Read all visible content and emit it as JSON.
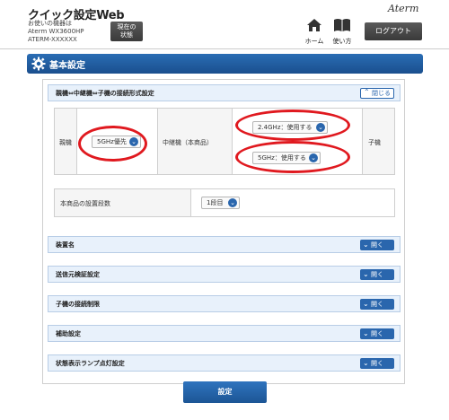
{
  "header": {
    "app_title": "クイック設定Web",
    "device_lines": [
      "お使いの機器は",
      "Aterm WX3600HP",
      "ATERM-XXXXXX"
    ],
    "status_button": [
      "現在の",
      "状態"
    ],
    "brand": "Aterm",
    "home_label": "ホーム",
    "help_label": "使い方",
    "logout_label": "ログアウト"
  },
  "page": {
    "title": "基本設定",
    "accent_color": "#1f5ea3",
    "highlight_color": "#e0191f"
  },
  "connection": {
    "section_title": "親機⇔中継機⇔子機の接続形式設定",
    "close_label": "閉じる",
    "parent_label": "親機",
    "parent_value": "5GHz優先",
    "relay_label": "中継機（本商品）",
    "relay_value_24": "2.4GHz：使用する",
    "relay_value_5": "5GHz：使用する",
    "child_label": "子機"
  },
  "install_count": {
    "label": "本商品の設置段数",
    "value": "1段目"
  },
  "sections": [
    {
      "title": "装置名",
      "button": "開く"
    },
    {
      "title": "送信元検証設定",
      "button": "開く"
    },
    {
      "title": "子機の接続制限",
      "button": "開く"
    },
    {
      "title": "補助設定",
      "button": "開く"
    },
    {
      "title": "状態表示ランプ点灯設定",
      "button": "開く"
    }
  ],
  "submit_label": "設定"
}
